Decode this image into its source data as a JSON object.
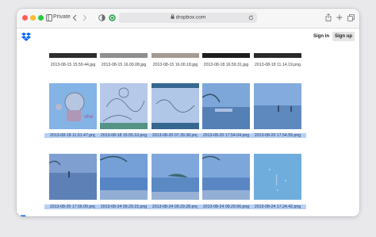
{
  "browser": {
    "tab_label": "Private",
    "url": "dropbox.com"
  },
  "header": {
    "sign_in": "Sign in",
    "sign_up": "Sign up"
  },
  "files": {
    "row0": [
      "2013-08-15 15.59.44.jpg",
      "2013-08-15 16.00.08.jpg",
      "2013-08-15 16.00.18.jpg",
      "2013-08-18 16.59.31.jpg",
      "2013-08-18 11.14.19.png"
    ],
    "row1": [
      "2013-08-18 11.51.47.png",
      "2013-08-18 15.55.10.png",
      "2013-08-20 07.39.38.png",
      "2013-08-20 17.54.04.png",
      "2013-08-20 17.54.55.png"
    ],
    "row2": [
      "2013-08-20 17.56.00.png",
      "2013-08-24 09.29.15.png",
      "2013-08-24 09.29.28.png",
      "2013-08-24 09.29.56.png",
      "2013-08-24 17.24.42.png"
    ]
  },
  "colors": {
    "selection": "#b7cff2",
    "dropbox_blue": "#0061fe"
  }
}
